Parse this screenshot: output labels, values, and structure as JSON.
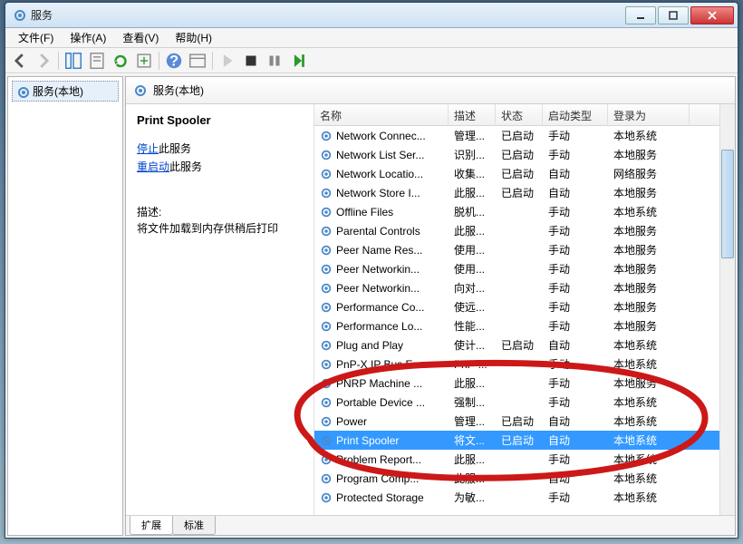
{
  "window": {
    "title": "服务"
  },
  "menus": [
    "文件(F)",
    "操作(A)",
    "查看(V)",
    "帮助(H)"
  ],
  "tree": {
    "root": "服务(本地)"
  },
  "main": {
    "heading": "服务(本地)"
  },
  "detail": {
    "selected_name": "Print Spooler",
    "stop_link": "停止",
    "stop_suffix": "此服务",
    "restart_link": "重启动",
    "restart_suffix": "此服务",
    "desc_label": "描述:",
    "desc_text": "将文件加载到内存供稍后打印"
  },
  "columns": [
    "名称",
    "描述",
    "状态",
    "启动类型",
    "登录为"
  ],
  "tabs": {
    "extended": "扩展",
    "standard": "标准"
  },
  "services": [
    {
      "name": "Network Connec...",
      "desc": "管理...",
      "status": "已启动",
      "startup": "手动",
      "logon": "本地系统"
    },
    {
      "name": "Network List Ser...",
      "desc": "识别...",
      "status": "已启动",
      "startup": "手动",
      "logon": "本地服务"
    },
    {
      "name": "Network Locatio...",
      "desc": "收集...",
      "status": "已启动",
      "startup": "自动",
      "logon": "网络服务"
    },
    {
      "name": "Network Store I...",
      "desc": "此服...",
      "status": "已启动",
      "startup": "自动",
      "logon": "本地服务"
    },
    {
      "name": "Offline Files",
      "desc": "脱机...",
      "status": "",
      "startup": "手动",
      "logon": "本地系统"
    },
    {
      "name": "Parental Controls",
      "desc": "此服...",
      "status": "",
      "startup": "手动",
      "logon": "本地服务"
    },
    {
      "name": "Peer Name Res...",
      "desc": "使用...",
      "status": "",
      "startup": "手动",
      "logon": "本地服务"
    },
    {
      "name": "Peer Networkin...",
      "desc": "使用...",
      "status": "",
      "startup": "手动",
      "logon": "本地服务"
    },
    {
      "name": "Peer Networkin...",
      "desc": "向对...",
      "status": "",
      "startup": "手动",
      "logon": "本地服务"
    },
    {
      "name": "Performance Co...",
      "desc": "使远...",
      "status": "",
      "startup": "手动",
      "logon": "本地服务"
    },
    {
      "name": "Performance Lo...",
      "desc": "性能...",
      "status": "",
      "startup": "手动",
      "logon": "本地服务"
    },
    {
      "name": "Plug and Play",
      "desc": "使计...",
      "status": "已启动",
      "startup": "自动",
      "logon": "本地系统"
    },
    {
      "name": "PnP-X IP Bus En...",
      "desc": "PnP-...",
      "status": "",
      "startup": "手动",
      "logon": "本地系统"
    },
    {
      "name": "PNRP Machine ...",
      "desc": "此服...",
      "status": "",
      "startup": "手动",
      "logon": "本地服务"
    },
    {
      "name": "Portable Device ...",
      "desc": "强制...",
      "status": "",
      "startup": "手动",
      "logon": "本地系统"
    },
    {
      "name": "Power",
      "desc": "管理...",
      "status": "已启动",
      "startup": "自动",
      "logon": "本地系统"
    },
    {
      "name": "Print Spooler",
      "desc": "将文...",
      "status": "已启动",
      "startup": "自动",
      "logon": "本地系统",
      "selected": true
    },
    {
      "name": "Problem Report...",
      "desc": "此服...",
      "status": "",
      "startup": "手动",
      "logon": "本地系统"
    },
    {
      "name": "Program Comp...",
      "desc": "此服...",
      "status": "",
      "startup": "自动",
      "logon": "本地系统"
    },
    {
      "name": "Protected Storage",
      "desc": "为敏...",
      "status": "",
      "startup": "手动",
      "logon": "本地系统"
    }
  ]
}
